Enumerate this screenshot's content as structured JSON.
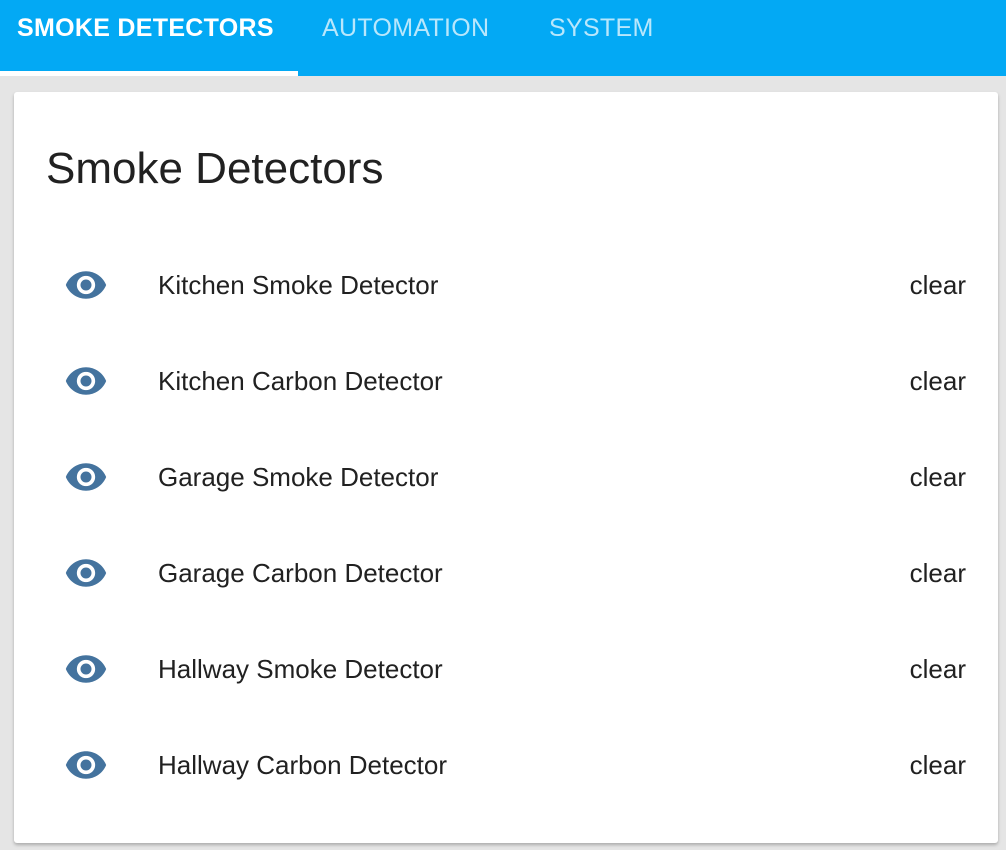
{
  "tabs": [
    {
      "label": "SMOKE DETECTORS",
      "active": true
    },
    {
      "label": "AUTOMATION",
      "active": false
    },
    {
      "label": "SYSTEM",
      "active": false
    }
  ],
  "colors": {
    "header": "#03a9f4",
    "icon": "#44739e"
  },
  "card": {
    "title": "Smoke Detectors",
    "rows": [
      {
        "icon": "eye-icon",
        "name": "Kitchen Smoke Detector",
        "state": "clear"
      },
      {
        "icon": "eye-icon",
        "name": "Kitchen Carbon Detector",
        "state": "clear"
      },
      {
        "icon": "eye-icon",
        "name": "Garage Smoke Detector",
        "state": "clear"
      },
      {
        "icon": "eye-icon",
        "name": "Garage Carbon Detector",
        "state": "clear"
      },
      {
        "icon": "eye-icon",
        "name": "Hallway Smoke Detector",
        "state": "clear"
      },
      {
        "icon": "eye-icon",
        "name": "Hallway Carbon Detector",
        "state": "clear"
      }
    ]
  }
}
